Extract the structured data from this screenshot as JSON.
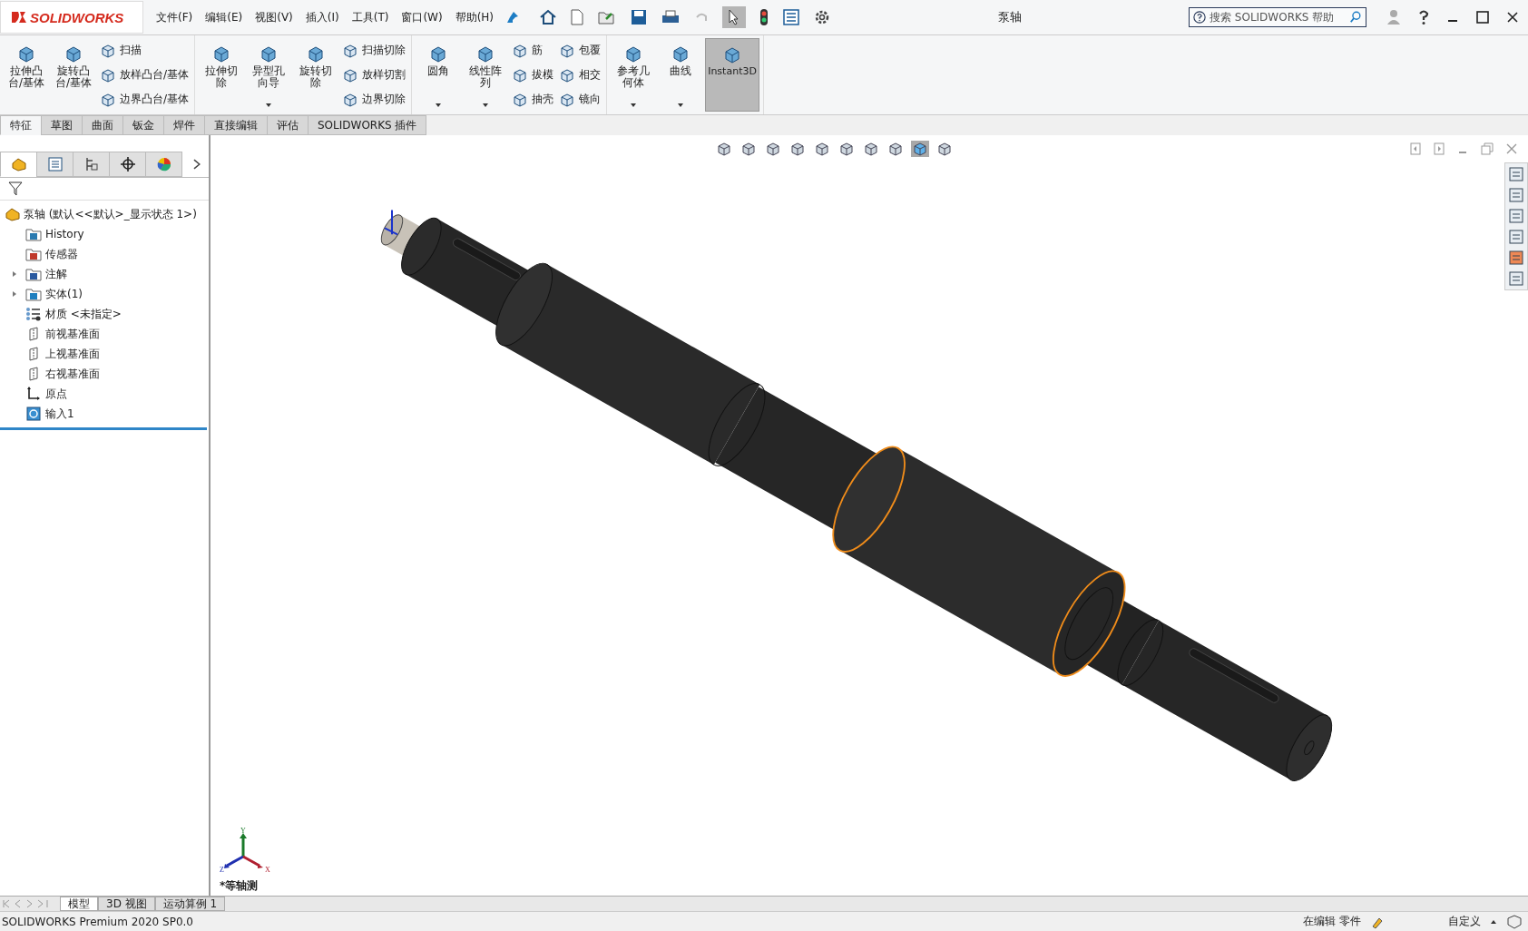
{
  "app": {
    "logo": "SOLIDWORKS",
    "title": "泵轴"
  },
  "menu": [
    "文件(F)",
    "编辑(E)",
    "视图(V)",
    "插入(I)",
    "工具(T)",
    "窗口(W)",
    "帮助(H)"
  ],
  "search": {
    "placeholder": "搜索 SOLIDWORKS 帮助"
  },
  "ribbon": [
    {
      "columns": [
        {
          "kind": "large",
          "label": "拉伸凸台/基体",
          "dropdown": false,
          "selected": false
        },
        {
          "kind": "large",
          "label": "旋转凸台/基体",
          "dropdown": false,
          "selected": false
        },
        {
          "kind": "stack",
          "items": [
            "扫描",
            "放样凸台/基体",
            "边界凸台/基体"
          ]
        }
      ]
    },
    {
      "columns": [
        {
          "kind": "large",
          "label": "拉伸切除",
          "dropdown": false,
          "selected": false
        },
        {
          "kind": "large",
          "label": "异型孔向导",
          "dropdown": true,
          "selected": false
        },
        {
          "kind": "large",
          "label": "旋转切除",
          "dropdown": false,
          "selected": false
        },
        {
          "kind": "stack",
          "items": [
            "扫描切除",
            "放样切割",
            "边界切除"
          ]
        }
      ]
    },
    {
      "columns": [
        {
          "kind": "large",
          "label": "圆角",
          "dropdown": true,
          "selected": false
        },
        {
          "kind": "large",
          "label": "线性阵列",
          "dropdown": true,
          "selected": false
        },
        {
          "kind": "stack",
          "items": [
            "筋",
            "拔模",
            "抽壳"
          ]
        },
        {
          "kind": "stack",
          "items": [
            "包覆",
            "相交",
            "镜向"
          ]
        }
      ]
    },
    {
      "columns": [
        {
          "kind": "large",
          "label": "参考几何体",
          "dropdown": true,
          "selected": false
        },
        {
          "kind": "large",
          "label": "曲线",
          "dropdown": true,
          "selected": false
        },
        {
          "kind": "large",
          "label": "Instant3D",
          "dropdown": false,
          "selected": true
        }
      ]
    }
  ],
  "tabs": [
    {
      "label": "特征",
      "selected": true
    },
    {
      "label": "草图",
      "selected": false
    },
    {
      "label": "曲面",
      "selected": false
    },
    {
      "label": "钣金",
      "selected": false
    },
    {
      "label": "焊件",
      "selected": false
    },
    {
      "label": "直接编辑",
      "selected": false
    },
    {
      "label": "评估",
      "selected": false
    },
    {
      "label": "SOLIDWORKS 插件",
      "selected": false
    }
  ],
  "tree": {
    "root": "泵轴 (默认<<默认>_显示状态 1>)",
    "items": [
      {
        "kind": "history",
        "label": "History"
      },
      {
        "kind": "sensor",
        "label": "传感器"
      },
      {
        "kind": "annotation",
        "label": "注解",
        "expanded": false
      },
      {
        "kind": "solid",
        "label": "实体(1)",
        "expanded": false
      },
      {
        "kind": "material",
        "label": "材质 <未指定>"
      },
      {
        "kind": "plane",
        "label": "前视基准面"
      },
      {
        "kind": "plane",
        "label": "上视基准面"
      },
      {
        "kind": "plane",
        "label": "右视基准面"
      },
      {
        "kind": "origin",
        "label": "原点"
      },
      {
        "kind": "import",
        "label": "输入1"
      }
    ]
  },
  "viewport": {
    "view_name": "*等轴测",
    "axes": [
      "Y",
      "Z",
      "X"
    ]
  },
  "bottom_tabs": [
    {
      "label": "模型",
      "selected": true
    },
    {
      "label": "3D 视图",
      "selected": false
    },
    {
      "label": "运动算例 1",
      "selected": false
    }
  ],
  "status_bar": {
    "product": "SOLIDWORKS Premium 2020 SP0.0",
    "mode": "在编辑 零件",
    "units": "自定义"
  }
}
